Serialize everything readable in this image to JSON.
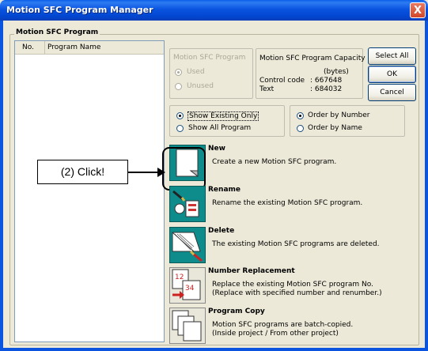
{
  "window": {
    "title": "Motion SFC Program Manager",
    "close_glyph": "X"
  },
  "group": {
    "label": "Motion SFC Program"
  },
  "list": {
    "col_no": "No.",
    "col_name": "Program Name"
  },
  "filter_box": {
    "legend": "Motion SFC Program",
    "used": "Used",
    "unused": "Unused"
  },
  "capacity": {
    "title": "Motion SFC Program Capacity",
    "unit": "(bytes)",
    "control_code_label": "Control code",
    "control_code_value": ": 667648",
    "text_label": "Text",
    "text_value": ": 684032"
  },
  "buttons": {
    "select_all": "Select All",
    "ok": "OK",
    "cancel": "Cancel"
  },
  "show": {
    "existing_only": "Show Existing Only",
    "all_program": "Show All Program"
  },
  "order": {
    "by_number": "Order by Number",
    "by_name": "Order by Name"
  },
  "actions": {
    "new_label": "New",
    "new_desc": "Create a new Motion SFC program.",
    "rename_label": "Rename",
    "rename_desc": "Rename the existing Motion SFC program.",
    "delete_label": "Delete",
    "delete_desc": "The existing Motion SFC programs are deleted.",
    "numrep_label": "Number Replacement",
    "numrep_desc1": "Replace the existing Motion SFC program No.",
    "numrep_desc2": "(Replace with specified number and renumber.)",
    "numrep_icon_a": "12",
    "numrep_icon_b": "34",
    "copy_label": "Program Copy",
    "copy_desc1": "Motion SFC programs are batch-copied.",
    "copy_desc2": "(Inside project / From other project)"
  },
  "annotation": {
    "callout": "(2) Click!"
  },
  "colors": {
    "titlebar": "#0a54e0",
    "icon_teal": "#0e8c8c",
    "dialog_bg": "#ece9d8"
  }
}
